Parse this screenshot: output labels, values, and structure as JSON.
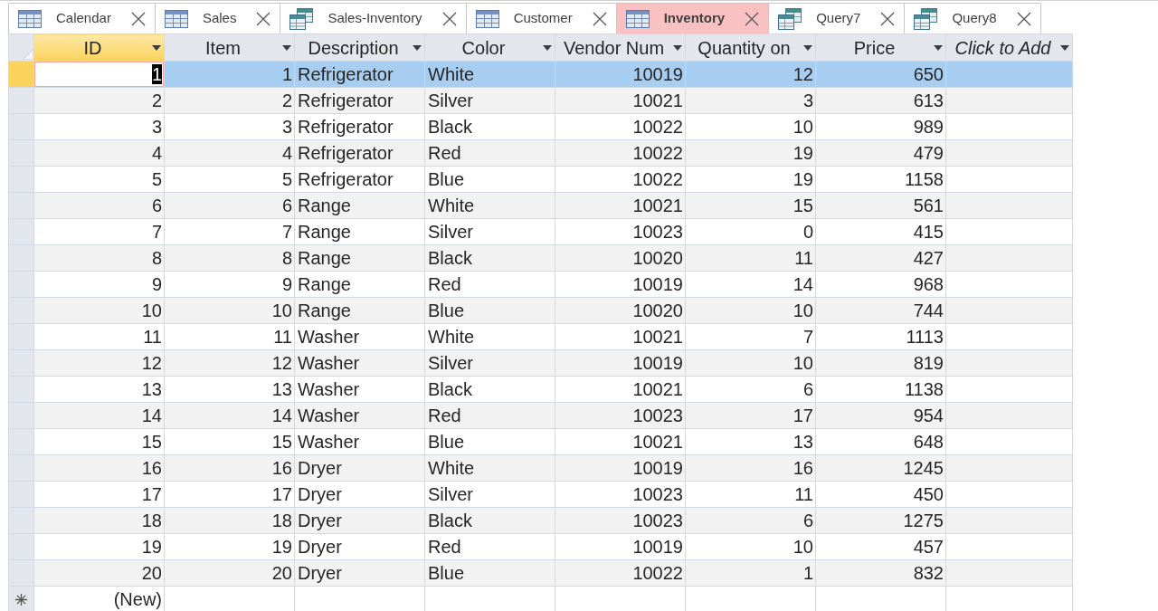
{
  "tabs": [
    {
      "label": "Calendar",
      "kind": "table",
      "selected": false
    },
    {
      "label": "Sales",
      "kind": "table",
      "selected": false
    },
    {
      "label": "Sales-Inventory",
      "kind": "query",
      "selected": false
    },
    {
      "label": "Customer",
      "kind": "table",
      "selected": false
    },
    {
      "label": "Inventory",
      "kind": "table",
      "selected": true
    },
    {
      "label": "Query7",
      "kind": "query",
      "selected": false
    },
    {
      "label": "Query8",
      "kind": "query",
      "selected": false
    }
  ],
  "columns": [
    {
      "label": "ID",
      "kind": "number",
      "selected": true
    },
    {
      "label": "Item",
      "kind": "number",
      "selected": false
    },
    {
      "label": "Description",
      "kind": "text",
      "selected": false
    },
    {
      "label": "Color",
      "kind": "text",
      "selected": false
    },
    {
      "label": "Vendor Num",
      "kind": "number",
      "selected": false
    },
    {
      "label": "Quantity on",
      "kind": "number",
      "selected": false
    },
    {
      "label": "Price",
      "kind": "number",
      "selected": false
    },
    {
      "label": "Click to Add",
      "kind": "add",
      "selected": false
    }
  ],
  "rows": [
    {
      "selected": true,
      "cells": [
        "1",
        "1",
        "Refrigerator",
        "White",
        "10019",
        "12",
        "650"
      ]
    },
    {
      "selected": false,
      "cells": [
        "2",
        "2",
        "Refrigerator",
        "Silver",
        "10021",
        "3",
        "613"
      ]
    },
    {
      "selected": false,
      "cells": [
        "3",
        "3",
        "Refrigerator",
        "Black",
        "10022",
        "10",
        "989"
      ]
    },
    {
      "selected": false,
      "cells": [
        "4",
        "4",
        "Refrigerator",
        "Red",
        "10022",
        "19",
        "479"
      ]
    },
    {
      "selected": false,
      "cells": [
        "5",
        "5",
        "Refrigerator",
        "Blue",
        "10022",
        "19",
        "1158"
      ]
    },
    {
      "selected": false,
      "cells": [
        "6",
        "6",
        "Range",
        "White",
        "10021",
        "15",
        "561"
      ]
    },
    {
      "selected": false,
      "cells": [
        "7",
        "7",
        "Range",
        "Silver",
        "10023",
        "0",
        "415"
      ]
    },
    {
      "selected": false,
      "cells": [
        "8",
        "8",
        "Range",
        "Black",
        "10020",
        "11",
        "427"
      ]
    },
    {
      "selected": false,
      "cells": [
        "9",
        "9",
        "Range",
        "Red",
        "10019",
        "14",
        "968"
      ]
    },
    {
      "selected": false,
      "cells": [
        "10",
        "10",
        "Range",
        "Blue",
        "10020",
        "10",
        "744"
      ]
    },
    {
      "selected": false,
      "cells": [
        "11",
        "11",
        "Washer",
        "White",
        "10021",
        "7",
        "1113"
      ]
    },
    {
      "selected": false,
      "cells": [
        "12",
        "12",
        "Washer",
        "Silver",
        "10019",
        "10",
        "819"
      ]
    },
    {
      "selected": false,
      "cells": [
        "13",
        "13",
        "Washer",
        "Black",
        "10021",
        "6",
        "1138"
      ]
    },
    {
      "selected": false,
      "cells": [
        "14",
        "14",
        "Washer",
        "Red",
        "10023",
        "17",
        "954"
      ]
    },
    {
      "selected": false,
      "cells": [
        "15",
        "15",
        "Washer",
        "Blue",
        "10021",
        "13",
        "648"
      ]
    },
    {
      "selected": false,
      "cells": [
        "16",
        "16",
        "Dryer",
        "White",
        "10019",
        "16",
        "1245"
      ]
    },
    {
      "selected": false,
      "cells": [
        "17",
        "17",
        "Dryer",
        "Silver",
        "10023",
        "11",
        "450"
      ]
    },
    {
      "selected": false,
      "cells": [
        "18",
        "18",
        "Dryer",
        "Black",
        "10023",
        "6",
        "1275"
      ]
    },
    {
      "selected": false,
      "cells": [
        "19",
        "19",
        "Dryer",
        "Red",
        "10019",
        "10",
        "457"
      ]
    },
    {
      "selected": false,
      "cells": [
        "20",
        "20",
        "Dryer",
        "Blue",
        "10022",
        "1",
        "832"
      ]
    }
  ],
  "new_row": {
    "label": "(New)"
  }
}
